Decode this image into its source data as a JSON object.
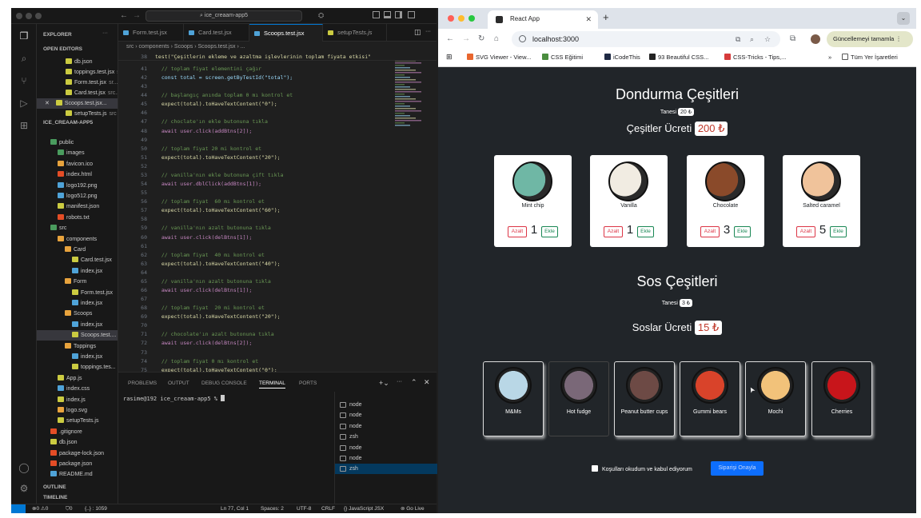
{
  "vscode": {
    "search": "ice_creaam-app5",
    "explorer_title": "EXPLORER",
    "open_editors_title": "OPEN EDITORS",
    "open_editors": [
      {
        "name": "db.json",
        "path": "",
        "color": "#cbcb41"
      },
      {
        "name": "toppings.test.jsx",
        "path": "sr...",
        "color": "#cbcb41"
      },
      {
        "name": "Form.test.jsx",
        "path": "sr...",
        "color": "#cbcb41"
      },
      {
        "name": "Card.test.jsx",
        "path": "src...",
        "color": "#cbcb41"
      },
      {
        "name": "Scoops.test.jsx...",
        "path": "",
        "color": "#cbcb41"
      },
      {
        "name": "setupTests.js",
        "path": "src",
        "color": "#cbcb41"
      }
    ],
    "project_title": "ICE_CREAAM-APP5",
    "tree": [
      {
        "name": "public",
        "color": "#4a9c5e",
        "indent": 1
      },
      {
        "name": "images",
        "color": "#4a9c5e",
        "indent": 2
      },
      {
        "name": "favicon.ico",
        "color": "#e8a33d",
        "indent": 2
      },
      {
        "name": "index.html",
        "color": "#e44d26",
        "indent": 2
      },
      {
        "name": "logo192.png",
        "color": "#4fa3d8",
        "indent": 2
      },
      {
        "name": "logo512.png",
        "color": "#4fa3d8",
        "indent": 2
      },
      {
        "name": "manifest.json",
        "color": "#cbcb41",
        "indent": 2
      },
      {
        "name": "robots.txt",
        "color": "#e44d26",
        "indent": 2
      },
      {
        "name": "src",
        "color": "#4a9c5e",
        "indent": 1
      },
      {
        "name": "components",
        "color": "#e8a33d",
        "indent": 2
      },
      {
        "name": "Card",
        "color": "#e8a33d",
        "indent": 3
      },
      {
        "name": "Card.test.jsx",
        "color": "#cbcb41",
        "indent": 4
      },
      {
        "name": "index.jsx",
        "color": "#4fa3d8",
        "indent": 4
      },
      {
        "name": "Form",
        "color": "#e8a33d",
        "indent": 3
      },
      {
        "name": "Form.test.jsx",
        "color": "#cbcb41",
        "indent": 4
      },
      {
        "name": "index.jsx",
        "color": "#4fa3d8",
        "indent": 4
      },
      {
        "name": "Scoops",
        "color": "#e8a33d",
        "indent": 3
      },
      {
        "name": "index.jsx",
        "color": "#4fa3d8",
        "indent": 4
      },
      {
        "name": "Scoops.test....",
        "color": "#cbcb41",
        "indent": 4
      },
      {
        "name": "Toppings",
        "color": "#e8a33d",
        "indent": 3
      },
      {
        "name": "index.jsx",
        "color": "#4fa3d8",
        "indent": 4
      },
      {
        "name": "toppings.tes...",
        "color": "#cbcb41",
        "indent": 4
      },
      {
        "name": "App.js",
        "color": "#cbcb41",
        "indent": 2
      },
      {
        "name": "index.css",
        "color": "#4fa3d8",
        "indent": 2
      },
      {
        "name": "index.js",
        "color": "#cbcb41",
        "indent": 2
      },
      {
        "name": "logo.svg",
        "color": "#e8a33d",
        "indent": 2
      },
      {
        "name": "setupTests.js",
        "color": "#cbcb41",
        "indent": 2
      },
      {
        "name": ".gitignore",
        "color": "#e44d26",
        "indent": 1
      },
      {
        "name": "db.json",
        "color": "#cbcb41",
        "indent": 1
      },
      {
        "name": "package-lock.json",
        "color": "#e44d26",
        "indent": 1
      },
      {
        "name": "package.json",
        "color": "#e44d26",
        "indent": 1
      },
      {
        "name": "README.md",
        "color": "#4fa3d8",
        "indent": 1
      }
    ],
    "outline_title": "OUTLINE",
    "timeline_title": "TIMELINE",
    "tabs": [
      {
        "label": "Form.test.jsx",
        "active": false
      },
      {
        "label": "Card.test.jsx",
        "active": false
      },
      {
        "label": "Scoops.test.jsx",
        "active": true
      },
      {
        "label": "setupTests.js",
        "active": false
      }
    ],
    "breadcrumbs": "src › components › Scoops › Scoops.test.jsx › ...",
    "sticky_line": "test(\"Çeşitlerin ekleme ve azaltma işlevlerinin toplam fiyata etkisi\"",
    "code": [
      {
        "n": "38",
        "t": ""
      },
      {
        "n": "41",
        "t": "  // toplam fiyat elementini çağır",
        "c": "#6a9955"
      },
      {
        "n": "42",
        "t": "  const total = screen.getByTestId(\"total\");",
        "c": "#9cdcfe"
      },
      {
        "n": "43",
        "t": ""
      },
      {
        "n": "44",
        "t": "  // başlangıç anında toplam 0 mı kontrol et",
        "c": "#6a9955"
      },
      {
        "n": "45",
        "t": "  expect(total).toHaveTextContent(\"0\");",
        "c": "#dcdcaa"
      },
      {
        "n": "46",
        "t": ""
      },
      {
        "n": "47",
        "t": "  // choclate'ın ekle butonuna tıkla",
        "c": "#6a9955"
      },
      {
        "n": "48",
        "t": "  await user.click(addBtns[2]);",
        "c": "#c586c0"
      },
      {
        "n": "49",
        "t": ""
      },
      {
        "n": "50",
        "t": "  // toplam fiyat 20 mi kontrol et",
        "c": "#6a9955"
      },
      {
        "n": "51",
        "t": "  expect(total).toHaveTextContent(\"20\");",
        "c": "#dcdcaa"
      },
      {
        "n": "52",
        "t": ""
      },
      {
        "n": "53",
        "t": "  // vanilla'nın ekle butonuna çift tıkla",
        "c": "#6a9955"
      },
      {
        "n": "54",
        "t": "  await user.dblClick(addBtns[1]);",
        "c": "#c586c0"
      },
      {
        "n": "55",
        "t": ""
      },
      {
        "n": "56",
        "t": "  // toplam fiyat  60 mı kontrol et",
        "c": "#6a9955"
      },
      {
        "n": "57",
        "t": "  expect(total).toHaveTextContent(\"60\");",
        "c": "#dcdcaa"
      },
      {
        "n": "58",
        "t": ""
      },
      {
        "n": "59",
        "t": "  // vanilla'nın azalt butonuna tıkla",
        "c": "#6a9955"
      },
      {
        "n": "60",
        "t": "  await user.click(delBtns[1]);",
        "c": "#c586c0"
      },
      {
        "n": "61",
        "t": ""
      },
      {
        "n": "62",
        "t": "  // toplam fiyat  40 mı kontrol et",
        "c": "#6a9955"
      },
      {
        "n": "63",
        "t": "  expect(total).toHaveTextContent(\"40\");",
        "c": "#dcdcaa"
      },
      {
        "n": "64",
        "t": ""
      },
      {
        "n": "65",
        "t": "  // vanilla'nın azalt butonuna tıkla",
        "c": "#6a9955"
      },
      {
        "n": "66",
        "t": "  await user.click(delBtns[1]);",
        "c": "#c586c0"
      },
      {
        "n": "67",
        "t": ""
      },
      {
        "n": "68",
        "t": "  // toplam fiyat  20 mi kontrol et",
        "c": "#6a9955"
      },
      {
        "n": "69",
        "t": "  expect(total).toHaveTextContent(\"20\");",
        "c": "#dcdcaa"
      },
      {
        "n": "70",
        "t": ""
      },
      {
        "n": "71",
        "t": "  // chocolate'ın azalt butonuna tıkla",
        "c": "#6a9955"
      },
      {
        "n": "72",
        "t": "  await user.click(delBtns[2]);",
        "c": "#c586c0"
      },
      {
        "n": "73",
        "t": ""
      },
      {
        "n": "74",
        "t": "  // toplam fiyat 0 mı kontrol et",
        "c": "#6a9955"
      },
      {
        "n": "75",
        "t": "  expect(total).toHaveTextContent(\"0\");",
        "c": "#dcdcaa"
      }
    ],
    "panel_tabs": [
      "PROBLEMS",
      "OUTPUT",
      "DEBUG CONSOLE",
      "TERMINAL",
      "PORTS"
    ],
    "terminal_prompt": "rasime@192 ice_creaam-app5 % ",
    "terminals": [
      "node",
      "node",
      "node",
      "zsh",
      "node",
      "node",
      "zsh"
    ],
    "status": {
      "problems": "⊗0 ⚠0",
      "ports": "⛉0",
      "selection": "{..} : 1059",
      "position": "Ln 77, Col 1",
      "spaces": "Spaces: 2",
      "encoding": "UTF-8",
      "eol": "CRLF",
      "language": "{} JavaScript JSX",
      "golive": "⊚ Go Live"
    }
  },
  "chrome": {
    "tab_title": "React App",
    "url": "localhost:3000",
    "update_button": "Güncellemeyi tamamla",
    "bookmarks": [
      {
        "label": "SVG Viewer - View...",
        "color": "#e8662e"
      },
      {
        "label": "CSS Eğitimi",
        "color": "#4a8d3f"
      },
      {
        "label": "iCodeThis",
        "color": "#1f2a44"
      },
      {
        "label": "93 Beautiful CSS...",
        "color": "#222"
      },
      {
        "label": "CSS-Tricks - Tips,...",
        "color": "#d63b3b"
      }
    ],
    "more_bookmarks": "»",
    "all_bookmarks": "Tüm Yer İşaretleri"
  },
  "app": {
    "scoops_title": "Dondurma Çeşitleri",
    "scoops_unit_label": "Tanesi",
    "scoops_unit_price": "20 ₺",
    "scoops_total_label": "Çeşitler Ücreti",
    "scoops_total": "200 ₺",
    "decrease_label": "Azalt",
    "increase_label": "Ekle",
    "scoops": [
      {
        "name": "Mint chip",
        "amount": "1",
        "color": "#6fb7a5"
      },
      {
        "name": "Vanilla",
        "amount": "1",
        "color": "#f1ece2"
      },
      {
        "name": "Chocolate",
        "amount": "3",
        "color": "#8a4a2a"
      },
      {
        "name": "Salted caramel",
        "amount": "5",
        "color": "#f0c39b"
      }
    ],
    "toppings_title": "Sos Çeşitleri",
    "toppings_unit_label": "Tanesi",
    "toppings_unit_price": "3 ₺",
    "toppings_total_label": "Soslar Ücreti",
    "toppings_total": "15 ₺",
    "toppings": [
      {
        "name": "M&Ms",
        "color": "#b9d7e6",
        "selected": false
      },
      {
        "name": "Hot fudge",
        "color": "#7a6878",
        "selected": true
      },
      {
        "name": "Peanut butter cups",
        "color": "#6d4a45",
        "selected": false
      },
      {
        "name": "Gummi bears",
        "color": "#d9432a",
        "selected": false
      },
      {
        "name": "Mochi",
        "color": "#f2c27a",
        "selected": false
      },
      {
        "name": "Cherries",
        "color": "#c8151b",
        "selected": false
      }
    ],
    "terms_label": "Koşulları okudum ve kabul ediyorum",
    "order_button": "Siparişi Onayla"
  }
}
